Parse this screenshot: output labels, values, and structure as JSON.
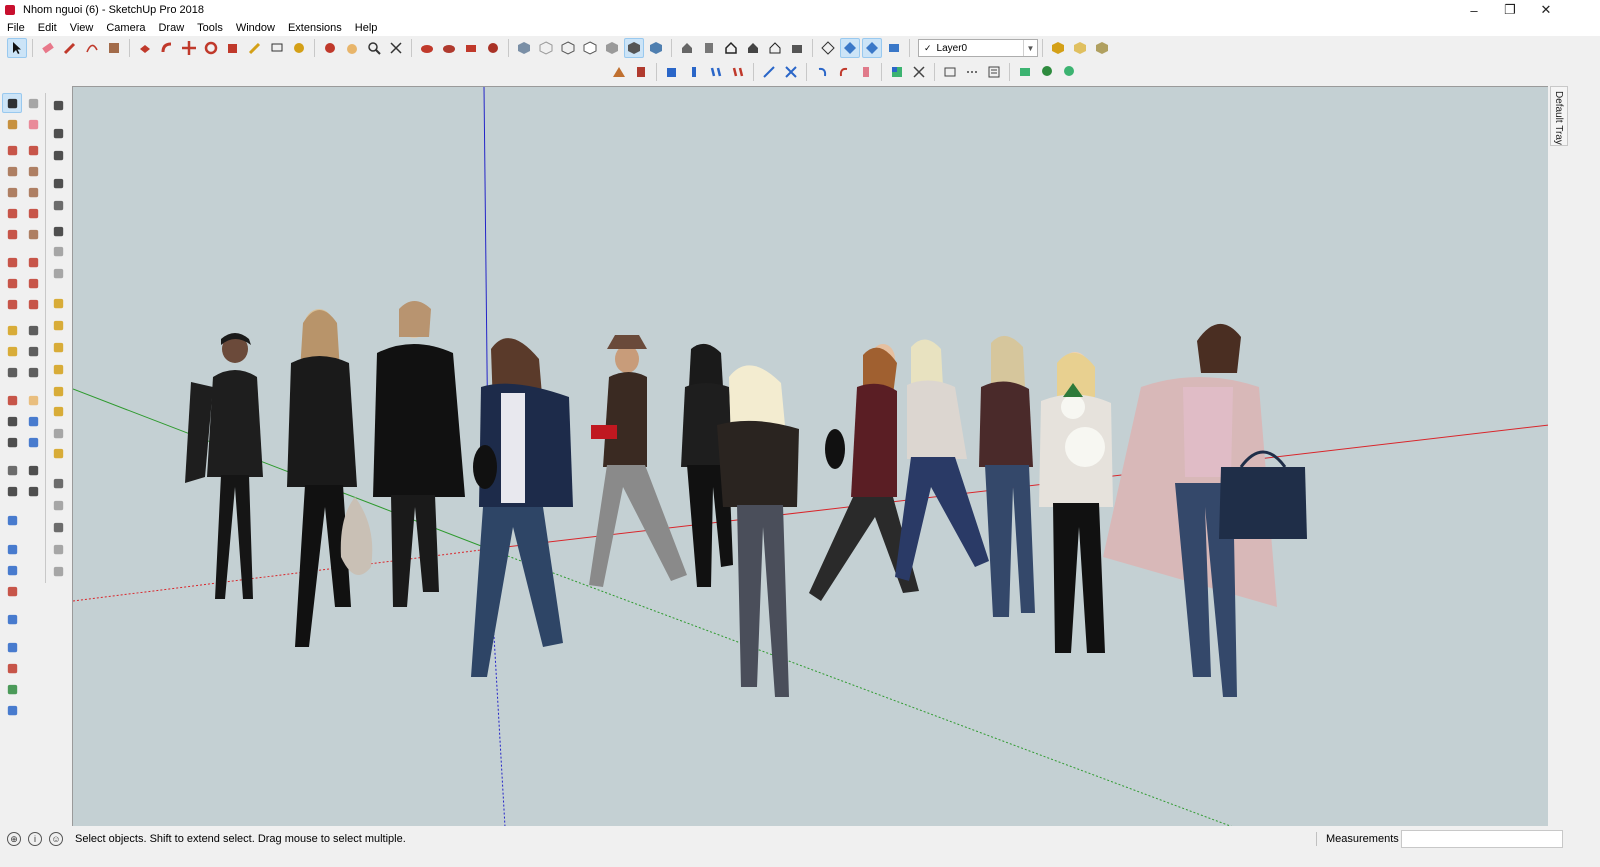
{
  "window": {
    "title": "Nhom nguoi (6) - SketchUp Pro 2018",
    "controls": {
      "minimize": "–",
      "restore": "❐",
      "close": "✕"
    }
  },
  "menu": [
    "File",
    "Edit",
    "View",
    "Camera",
    "Draw",
    "Tools",
    "Window",
    "Extensions",
    "Help"
  ],
  "toolbar": {
    "layer_selected": "Layer0",
    "layer_check": "✓"
  },
  "tray": {
    "label": "Default Tray"
  },
  "status": {
    "hint": "Select objects. Shift to extend select. Drag mouse to select multiple.",
    "measurements_label": "Measurements",
    "measurements_value": "",
    "icon_geo": "⊕",
    "icon_info": "i",
    "icon_user": "☺"
  },
  "colors": {
    "viewport_bg": "#c4d0d3",
    "axis_red": "#d9262b",
    "axis_green": "#2e9a2e",
    "axis_blue": "#2424c8",
    "selection_bg": "#cce4f7"
  },
  "scene": {
    "people_count_description": "cutout people group"
  }
}
